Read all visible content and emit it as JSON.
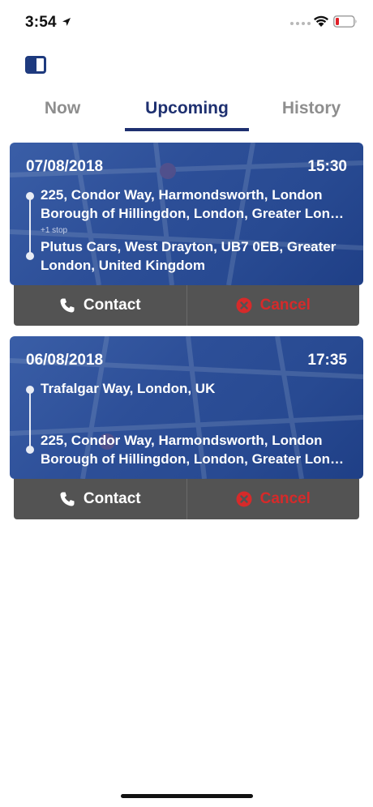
{
  "status_bar": {
    "time": "3:54"
  },
  "tabs": [
    {
      "label": "Now"
    },
    {
      "label": "Upcoming"
    },
    {
      "label": "History"
    }
  ],
  "active_tab": "Upcoming",
  "rides": [
    {
      "date": "07/08/2018",
      "time": "15:30",
      "pickup_line1": "225, Condor Way, Harmondsworth, London",
      "pickup_line2": "Borough of Hillingdon, London, Greater Lon…",
      "stops_label": "+1 stop",
      "dropoff_line1": "Plutus Cars, West Drayton, UB7 0EB, Greater",
      "dropoff_line2": "London, United Kingdom",
      "contact_label": "Contact",
      "cancel_label": "Cancel"
    },
    {
      "date": "06/08/2018",
      "time": "17:35",
      "pickup_line1": "Trafalgar Way, London, UK",
      "dropoff_line1": "225, Condor Way, Harmondsworth, London",
      "dropoff_line2": "Borough of Hillingdon, London, Greater Lon…",
      "contact_label": "Contact",
      "cancel_label": "Cancel"
    }
  ],
  "colors": {
    "brand": "#1e3070",
    "card": "#2d4f98",
    "action_bar": "#535353",
    "cancel": "#d62a2a"
  }
}
